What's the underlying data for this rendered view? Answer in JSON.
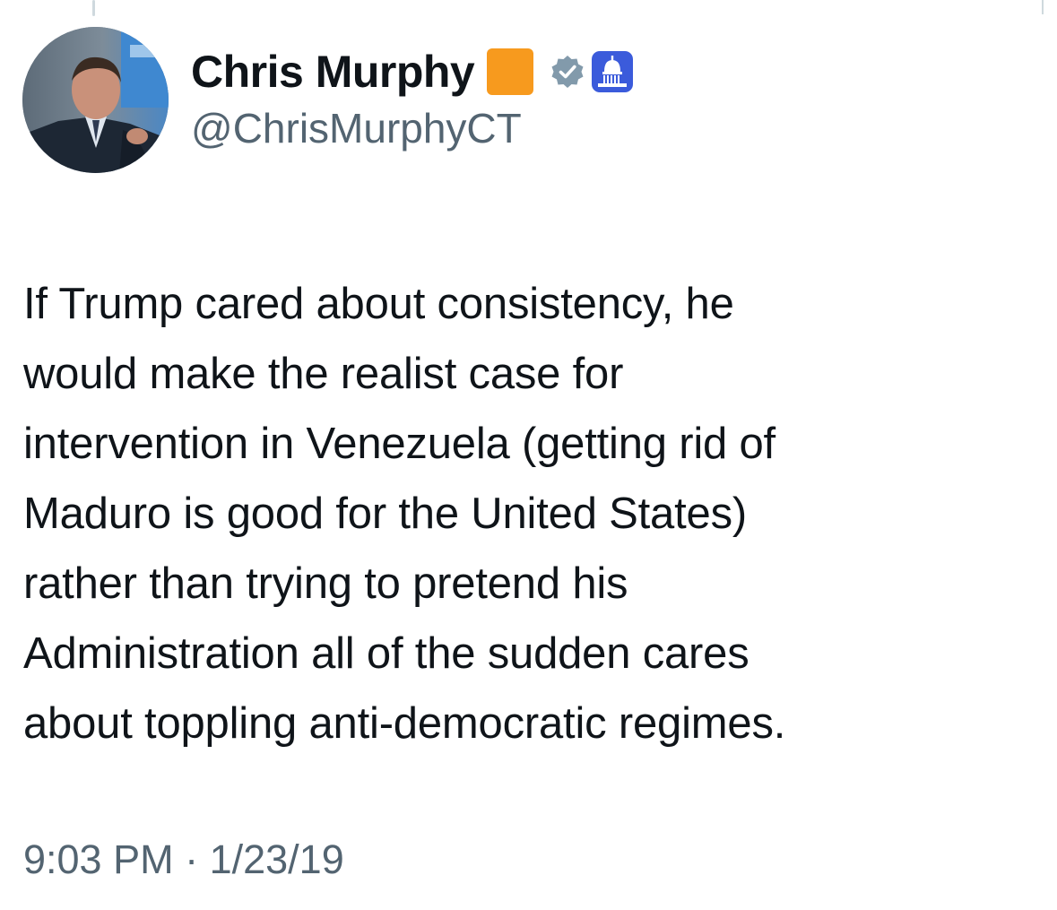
{
  "author": {
    "display_name": "Chris Murphy",
    "handle": "@ChrisMurphyCT",
    "avatar_icon": "profile-photo",
    "badges": [
      "orange-square-emoji",
      "verified-gray-checkmark-icon",
      "government-capitol-badge-icon"
    ]
  },
  "tweet": {
    "lines": [
      "If Trump cared about consistency, he",
      "would make the realist case for",
      "intervention in Venezuela (getting rid of",
      "Maduro is good for the United States)",
      "rather than trying to pretend his",
      "Administration all of the sudden cares",
      "about toppling anti-democratic regimes."
    ],
    "timestamp": "9:03 PM · 1/23/19"
  },
  "colors": {
    "text_primary": "#0f1419",
    "text_secondary": "#536471",
    "orange_square": "#f79a1e",
    "verified_gray": "#829aab",
    "gov_badge_blue": "#3b5bdb"
  }
}
